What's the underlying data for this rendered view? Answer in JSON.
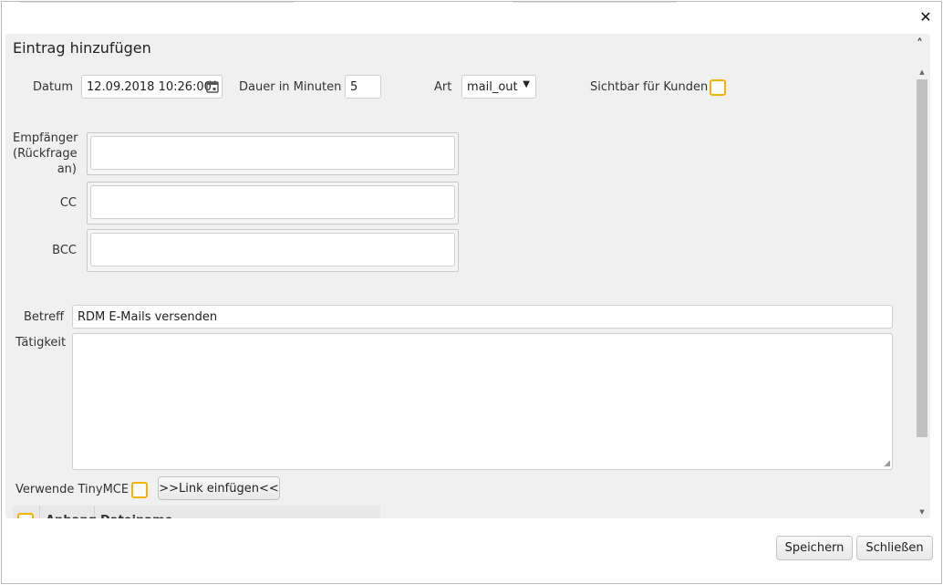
{
  "dialog": {
    "title": "Eintrag hinzufügen",
    "close_icon": "close-icon",
    "collapse_icon": "chevron-up-icon"
  },
  "form": {
    "datum_label": "Datum",
    "datum_value": "12.09.2018 10:26:00",
    "dauer_label": "Dauer in Minuten",
    "dauer_value": "5",
    "art_label": "Art",
    "art_value": "mail_out",
    "sichtbar_label": "Sichtbar für Kunden",
    "empfaenger_label_line1": "Empfänger",
    "empfaenger_label_line2": "(Rückfrage",
    "empfaenger_label_line3": "an)",
    "cc_label": "CC",
    "bcc_label": "BCC",
    "betreff_label": "Betreff",
    "betreff_value": "RDM E-Mails versenden",
    "taetigkeit_label": "Tätigkeit",
    "tinymce_label": "Verwende TinyMCE",
    "link_button": ">>Link einfügen<<"
  },
  "attachments_table": {
    "columns": [
      "Anhang",
      "Dateiname"
    ]
  },
  "footer": {
    "save_label": "Speichern",
    "close_label": "Schließen"
  },
  "colors": {
    "checkbox_border": "#f5b301",
    "panel_bg": "#f0f0f0"
  }
}
